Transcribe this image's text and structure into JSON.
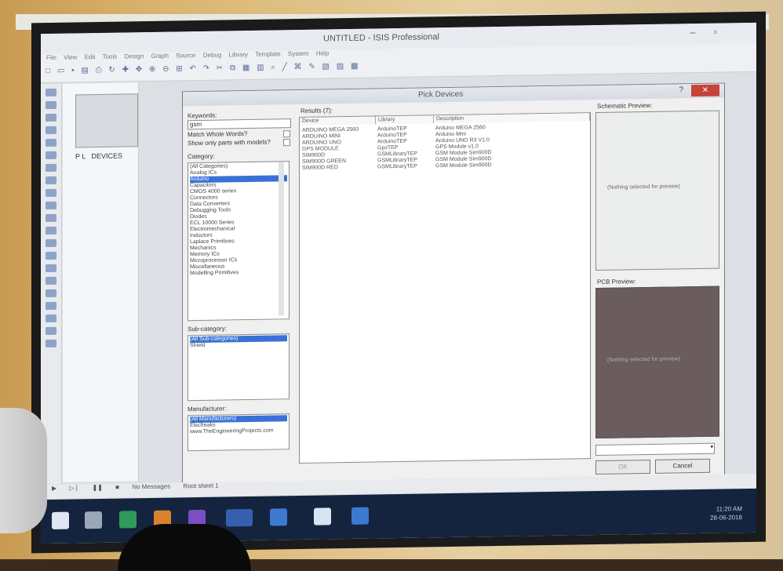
{
  "app": {
    "title": "UNTITLED - ISIS Professional",
    "window_controls": "–  ▫",
    "menu": [
      "File",
      "View",
      "Edit",
      "Tools",
      "Design",
      "Graph",
      "Source",
      "Debug",
      "Library",
      "Template",
      "System",
      "Help"
    ]
  },
  "device_panel": {
    "header": "DEVICES",
    "p_label": "P L"
  },
  "statusbar": {
    "no_messages": "No Messages",
    "sheet": "Root sheet 1"
  },
  "dialog": {
    "title": "Pick Devices",
    "help": "?",
    "close": "✕",
    "keywords_label": "Keywords:",
    "keywords_value": "gsm",
    "match_whole_words": "Match Whole Words?",
    "show_only_parts": "Show only parts with models?",
    "category_label": "Category:",
    "categories": [
      "(All Categories)",
      "Analog ICs",
      "Arduino",
      "Capacitors",
      "CMOS 4000 series",
      "Connectors",
      "Data Converters",
      "Debugging Tools",
      "Diodes",
      "ECL 10000 Series",
      "Electromechanical",
      "Inductors",
      "Laplace Primitives",
      "Mechanics",
      "Memory ICs",
      "Microprocessor ICs",
      "Miscellaneous",
      "Modelling Primitives"
    ],
    "selected_category_index": 2,
    "subcategory_label": "Sub-category:",
    "subcategories": [
      "(All Sub-categories)",
      "Shield"
    ],
    "manufacturer_label": "Manufacturer:",
    "manufacturers": [
      "(All Manufacturers)",
      "Elecfreaks",
      "www.TheEngineeringProjects.com"
    ],
    "results_label": "Results (7):",
    "columns": [
      "Device",
      "Library",
      "Description"
    ],
    "results": [
      {
        "device": "ARDUINO MEGA 2560",
        "library": "ArduinoTEP",
        "description": "Arduino MEGA 2560"
      },
      {
        "device": "ARDUINO MINI",
        "library": "ArduinoTEP",
        "description": "Arduino Mini"
      },
      {
        "device": "ARDUINO UNO",
        "library": "ArduinoTEP",
        "description": "Arduino UNO R3 V1.0"
      },
      {
        "device": "GPS MODULE",
        "library": "GpsTEP",
        "description": "GPS Module v1.0"
      },
      {
        "device": "SIM900D",
        "library": "GSMLibraryTEP",
        "description": "GSM Module Sim900D"
      },
      {
        "device": "SIM900D GREEN",
        "library": "GSMLibraryTEP",
        "description": "GSM Module Sim900D"
      },
      {
        "device": "SIM900D RED",
        "library": "GSMLibraryTEP",
        "description": "GSM Module Sim900D"
      }
    ],
    "schematic_preview_label": "Schematic Preview:",
    "schematic_preview_text": "(Nothing selected for preview)",
    "pcb_preview_label": "PCB Preview:",
    "pcb_preview_text": "(Nothing selected for preview)",
    "ok_label": "OK",
    "cancel_label": "Cancel"
  },
  "taskbar": {
    "time": "11:20 AM",
    "date": "28-06-2018"
  },
  "colors": {
    "selection": "#3a71d6",
    "close_button": "#c7423b",
    "taskbar": "#14243e"
  }
}
